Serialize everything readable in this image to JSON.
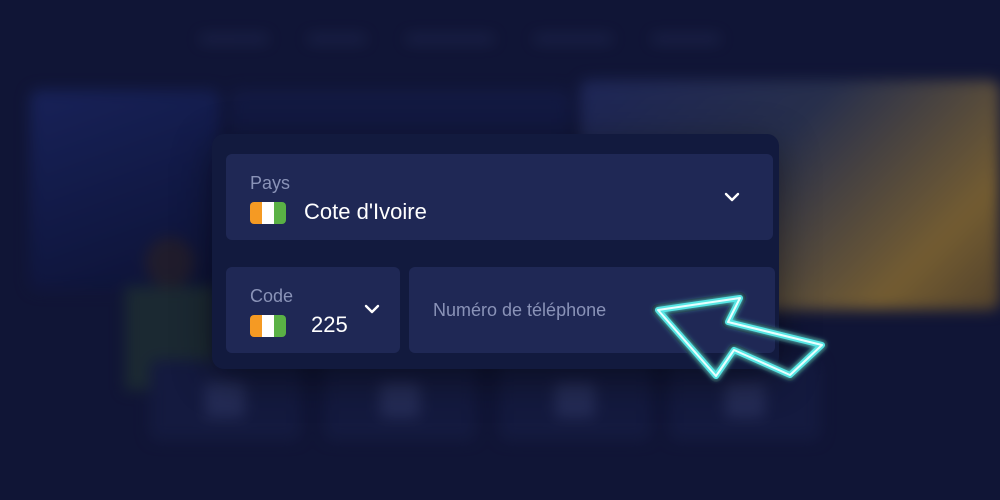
{
  "form": {
    "country": {
      "label": "Pays",
      "value": "Cote d'Ivoire",
      "flag_colors": [
        "#f59a23",
        "#ffffff",
        "#5ab145"
      ],
      "dropdown_icon": "chevron-down-icon"
    },
    "code": {
      "label": "Code",
      "value": "225",
      "flag_colors": [
        "#f59a23",
        "#ffffff",
        "#5ab145"
      ],
      "dropdown_icon": "chevron-down-icon"
    },
    "phone": {
      "value": "",
      "placeholder": "Numéro de téléphone"
    }
  },
  "pointer": {
    "icon": "neon-cursor-arrow-icon",
    "color": "#7ff3f0"
  },
  "colors": {
    "page_background": "#141b3f",
    "card_background": "#121a3e",
    "field_background": "#1f2855",
    "label_text": "#8a93b8",
    "value_text": "#ffffff"
  }
}
